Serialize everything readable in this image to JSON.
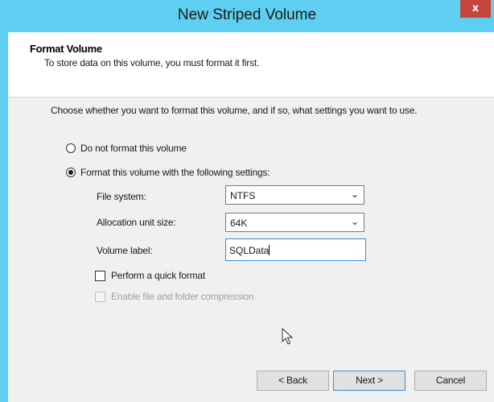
{
  "window": {
    "title": "New Striped Volume",
    "close_label": "x"
  },
  "header": {
    "title": "Format Volume",
    "subtitle": "To store data on this volume, you must format it first."
  },
  "main": {
    "intro": "Choose whether you want to format this volume, and if so, what settings you want to use.",
    "options": [
      {
        "label": "Do not format this volume",
        "selected": false
      },
      {
        "label": "Format this volume with the following settings:",
        "selected": true
      }
    ],
    "fields": {
      "file_system": {
        "label": "File system:",
        "value": "NTFS"
      },
      "allocation_unit": {
        "label": "Allocation unit size:",
        "value": "64K"
      },
      "volume_label": {
        "label": "Volume label:",
        "value": "SQLData"
      }
    },
    "quick_format": {
      "label": "Perform a quick format",
      "checked": false,
      "enabled": true
    },
    "compression": {
      "label": "Enable file and folder compression",
      "checked": false,
      "enabled": false
    }
  },
  "buttons": {
    "back": "< Back",
    "next": "Next >",
    "cancel": "Cancel"
  },
  "colors": {
    "titlebar": "#5ecff0",
    "close": "#c7443a",
    "dialog_bg": "#f0f0f0",
    "focus_border": "#3c8ed6"
  },
  "icons": {
    "close": "close-icon",
    "dropdown": "chevron-down-icon",
    "pointer": "mouse-pointer-icon"
  }
}
